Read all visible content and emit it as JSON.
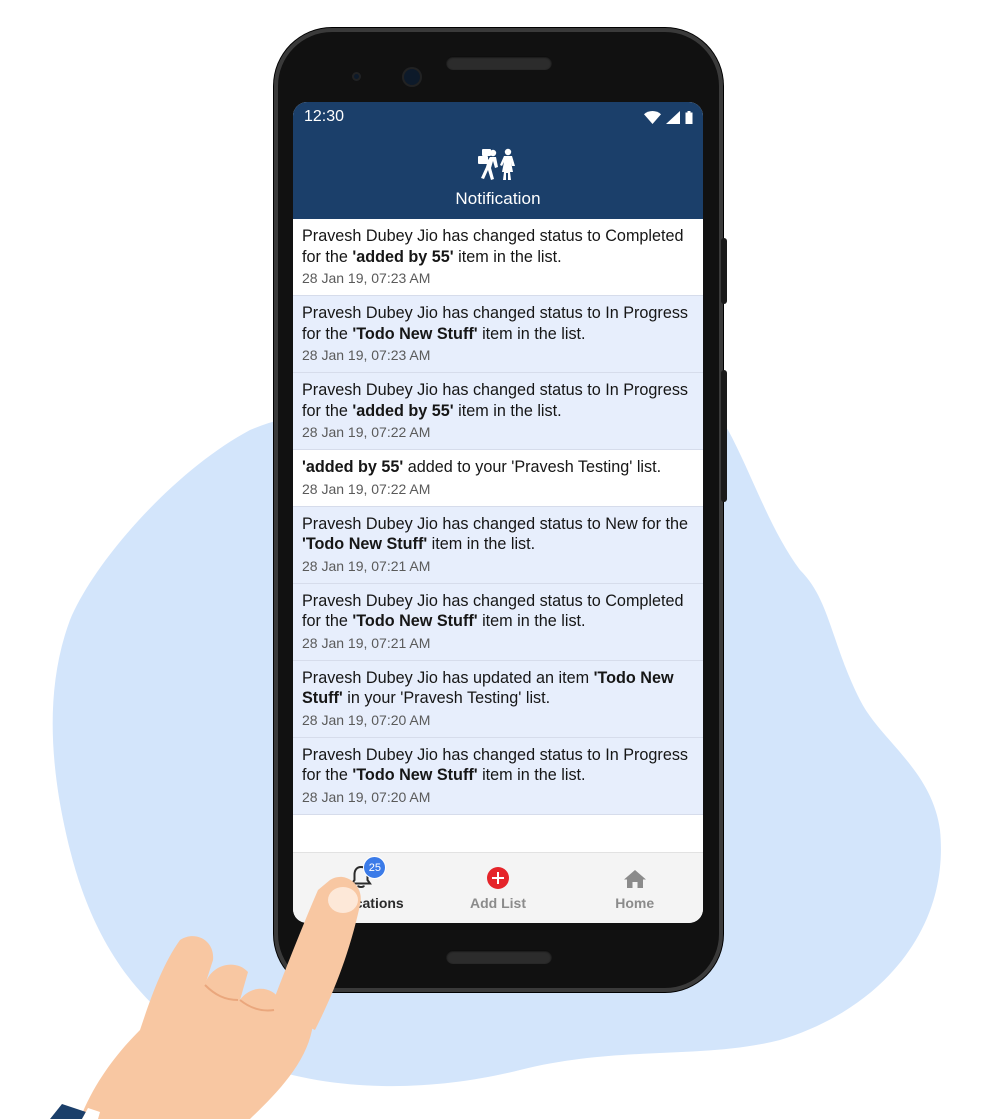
{
  "status_bar": {
    "time": "12:30"
  },
  "header": {
    "title": "Notification",
    "logo_icon": "people-carrying-boxes-icon"
  },
  "notifications": [
    {
      "pre": "Pravesh Dubey Jio has changed status to Completed for the ",
      "bold": "'added by 55'",
      "post": " item in the list.",
      "time": "28 Jan 19, 07:23 AM",
      "unread": false
    },
    {
      "pre": "Pravesh Dubey Jio has changed status to In Progress for the ",
      "bold": "'Todo New Stuff'",
      "post": " item in the list.",
      "time": "28 Jan 19, 07:23 AM",
      "unread": true
    },
    {
      "pre": "Pravesh Dubey Jio has changed status to In Progress for the ",
      "bold": "'added by 55'",
      "post": " item in the list.",
      "time": "28 Jan 19, 07:22 AM",
      "unread": true
    },
    {
      "pre": "",
      "bold": "'added by 55'",
      "post": " added to your 'Pravesh Testing' list.",
      "time": "28 Jan 19, 07:22 AM",
      "unread": false
    },
    {
      "pre": "Pravesh Dubey Jio has changed status to New for the ",
      "bold": "'Todo New Stuff'",
      "post": " item in the list.",
      "time": "28 Jan 19, 07:21 AM",
      "unread": true
    },
    {
      "pre": "Pravesh Dubey Jio has changed status to Completed for the ",
      "bold": "'Todo New Stuff'",
      "post": " item in the list.",
      "time": "28 Jan 19, 07:21 AM",
      "unread": true
    },
    {
      "pre": "Pravesh Dubey Jio has updated an item ",
      "bold": "'Todo New Stuff'",
      "post": " in your 'Pravesh Testing' list.",
      "time": "28 Jan 19, 07:20 AM",
      "unread": true
    },
    {
      "pre": "Pravesh Dubey Jio has changed status to In Progress for the ",
      "bold": "'Todo New Stuff'",
      "post": " item in the list.",
      "time": "28 Jan 19, 07:20 AM",
      "unread": true
    }
  ],
  "bottom_nav": {
    "notifications": {
      "label": "Notifications",
      "badge": "25",
      "icon": "bell-icon"
    },
    "add_list": {
      "label": "Add List",
      "icon": "plus-circle-icon"
    },
    "home": {
      "label": "Home",
      "icon": "home-icon"
    }
  },
  "colors": {
    "header_bg": "#1b3f6a",
    "unread_bg": "#e7eefc",
    "badge": "#3b7be8",
    "add_button": "#e5242a",
    "backdrop_blob": "#d3e5fb"
  }
}
